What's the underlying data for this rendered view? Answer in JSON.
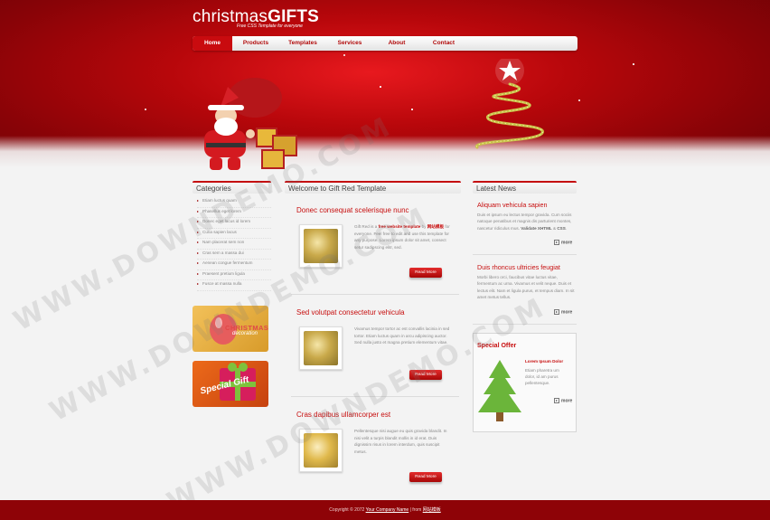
{
  "site": {
    "logo_plain": "christmas",
    "logo_bold": "GIFTS",
    "tagline": "Free CSS Template for everyone"
  },
  "nav": {
    "items": [
      {
        "label": "Home",
        "active": true
      },
      {
        "label": "Products",
        "active": false
      },
      {
        "label": "Templates",
        "active": false
      },
      {
        "label": "Services",
        "active": false
      },
      {
        "label": "About",
        "active": false
      },
      {
        "label": "Contact",
        "active": false
      }
    ]
  },
  "categories": {
    "title": "Categories",
    "items": [
      "Etiam luctus quam",
      "Phasellus eget lorem",
      "Donec eget lacus id lorem",
      "Cuna sapien lacus",
      "Nam placerat sem non",
      "Cras sem a massa dui",
      "Aenean congue fermentum",
      "Praesent pretium ligula",
      "Fusce at massa nulla"
    ],
    "banner_1_title": "CHRISTMAS",
    "banner_1_sub": "decoration",
    "banner_2_title": "Special Gift"
  },
  "main": {
    "title": "Welcome to Gift Red Template",
    "posts": [
      {
        "title": "Donec consequat scelerisque nunc",
        "text_start": "Gift Red is a ",
        "text_link": "free website template",
        "text_mid": " by ",
        "text_link2": "网站模板",
        "text_rest": " for everyone. Feel free to edit and use this template for any purpose. Lorem ipsum dolor sit amet, consect setur sadipscing elitr, sed.",
        "button": "Read More"
      },
      {
        "title": "Sed volutpat consectetur vehicula",
        "text": "Vivamus tempor tortor ac est convallis lacinia in sed tortor. Etiam luctus quam in arcu adipiscing auctor. Sed nulla justo et magna pretium elementum vitae.",
        "button": "Read More"
      },
      {
        "title": "Cras dapibus ullamcorper est",
        "text": "Pellentesque nisi augue eu quis gravida blandit. In nisi velit a turpis blandit mollis in id erat. Duis dignissim risus in lorem interdum, quis suscipit metus.",
        "button": "Read More"
      }
    ]
  },
  "news": {
    "title": "Latest News",
    "items": [
      {
        "title": "Aliquam vehicula sapien",
        "text_start": "Duis et ipsum eu lectus tempor gravida. Cum sociis natoque penatibus et magnis dis parturient montes, nascetur ridiculus mus. ",
        "text_bold": "Validate XHTML",
        "text_amp": " & ",
        "text_bold2": "CSS",
        "text_end": ".",
        "more": "more"
      },
      {
        "title": "Duis rhoncus ultricies feugiat",
        "text": "Morbi libero orci, faucibus vitae luctus vitae, fermentum ac urna. Vivamus et velit neque. Duis et lectus elit. Nam et ligula purus, et tempus diam. In sit amet metus tellus.",
        "more": "more"
      }
    ],
    "offer": {
      "title": "Special Offer",
      "subtitle": "Lorem Ipsum Dolor",
      "text": "Etiam pharetra um dolor, id am purus pellentesque.",
      "more": "more"
    }
  },
  "footer": {
    "copyright": "Copyright © 2072 ",
    "company": "Your Company Name",
    "separator": " | from ",
    "source": "网站模板"
  },
  "watermark": "WWW.DOWNDEMO.COM",
  "colors": {
    "brand_red": "#c70e0e",
    "header_dark": "#8a0307",
    "footer": "#8e0307",
    "nav_active": "#c90b0f"
  }
}
